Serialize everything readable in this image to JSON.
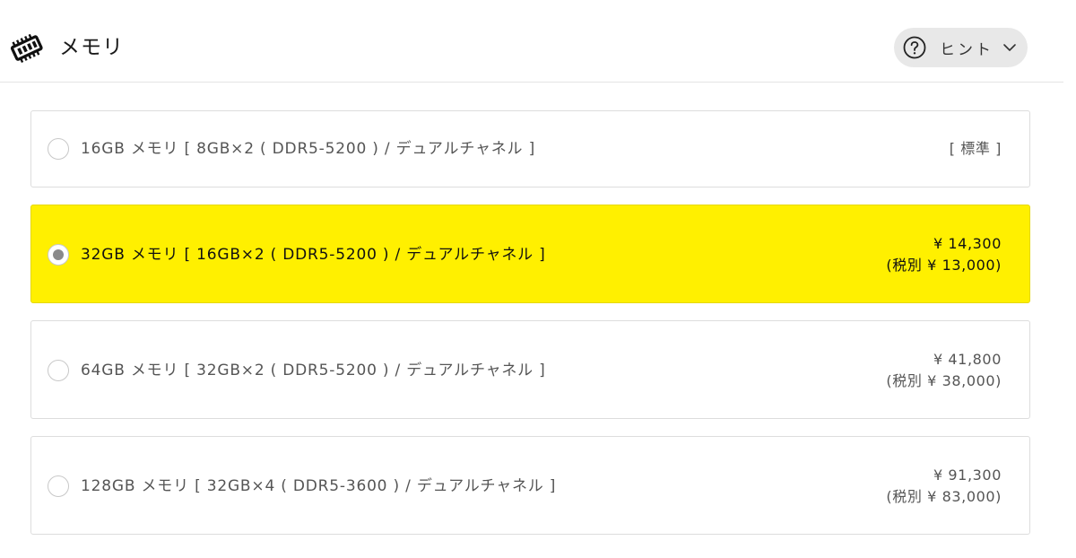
{
  "header": {
    "title": "メモリ",
    "icon": "memory-module-icon",
    "hint_button": {
      "label": "ヒント",
      "icon": "question-circle-icon",
      "chevron": "chevron-down-icon"
    }
  },
  "options": [
    {
      "label": "16GB メモリ [ 8GB×2 ( DDR5-5200 ) / デュアルチャネル ]",
      "price_line1": "[ 標準 ]",
      "price_line2": "",
      "selected": false
    },
    {
      "label": "32GB メモリ [ 16GB×2 ( DDR5-5200 ) / デュアルチャネル ]",
      "price_line1": "¥ 14,300",
      "price_line2": "(税別 ¥ 13,000)",
      "selected": true
    },
    {
      "label": "64GB メモリ [ 32GB×2 ( DDR5-5200 ) / デュアルチャネル ]",
      "price_line1": "¥ 41,800",
      "price_line2": "(税別 ¥ 38,000)",
      "selected": false
    },
    {
      "label": "128GB メモリ [ 32GB×4 ( DDR5-3600 ) / デュアルチャネル ]",
      "price_line1": "¥ 91,300",
      "price_line2": "(税別 ¥ 83,000)",
      "selected": false
    }
  ],
  "colors": {
    "selected_background": "#fff000",
    "border": "#dddddd",
    "radio_dot": "#8a8a8a",
    "hint_background": "#e8e8e8"
  }
}
